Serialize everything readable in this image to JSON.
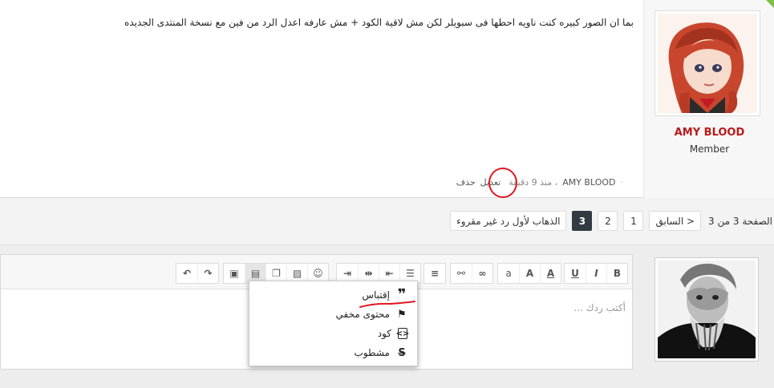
{
  "post": {
    "author_name": "AMY BLOOD",
    "author_rank": "Member",
    "message": "بما ان الصور كبيره كنت ناويه احطها فى سبويلر لكن مش لاقية الكود + مش عارفه اعدل الرد من فين مع نسخة المنتدى الجديده",
    "meta_dot": "·",
    "meta_author": "AMY BLOOD",
    "meta_time": "، منذ 9 دقيقة",
    "edit_label": "تعديل",
    "delete_label": "حذف",
    "accent_color": "#b81a1a"
  },
  "pagination": {
    "info": "الصفحة 3 من 3",
    "prev_label": "< السابق",
    "pages": [
      "1",
      "2",
      "3"
    ],
    "current_page": "3",
    "first_unread_label": "الذهاب لأول رد غير مقروء"
  },
  "editor": {
    "placeholder": "أكتب ردك ...",
    "toolbar": {
      "bold": "B",
      "italic": "I",
      "underline": "U",
      "font_color": "A",
      "font_size": "A",
      "font_family": "a"
    }
  },
  "dropdown": {
    "items": [
      {
        "label": "إقتباس",
        "icon": "quote-icon"
      },
      {
        "label": "محتوى مخفي",
        "icon": "flag-icon"
      },
      {
        "label": "كود",
        "icon": "code-icon"
      },
      {
        "label": "مشطوب",
        "icon": "strikethrough-icon"
      }
    ]
  }
}
